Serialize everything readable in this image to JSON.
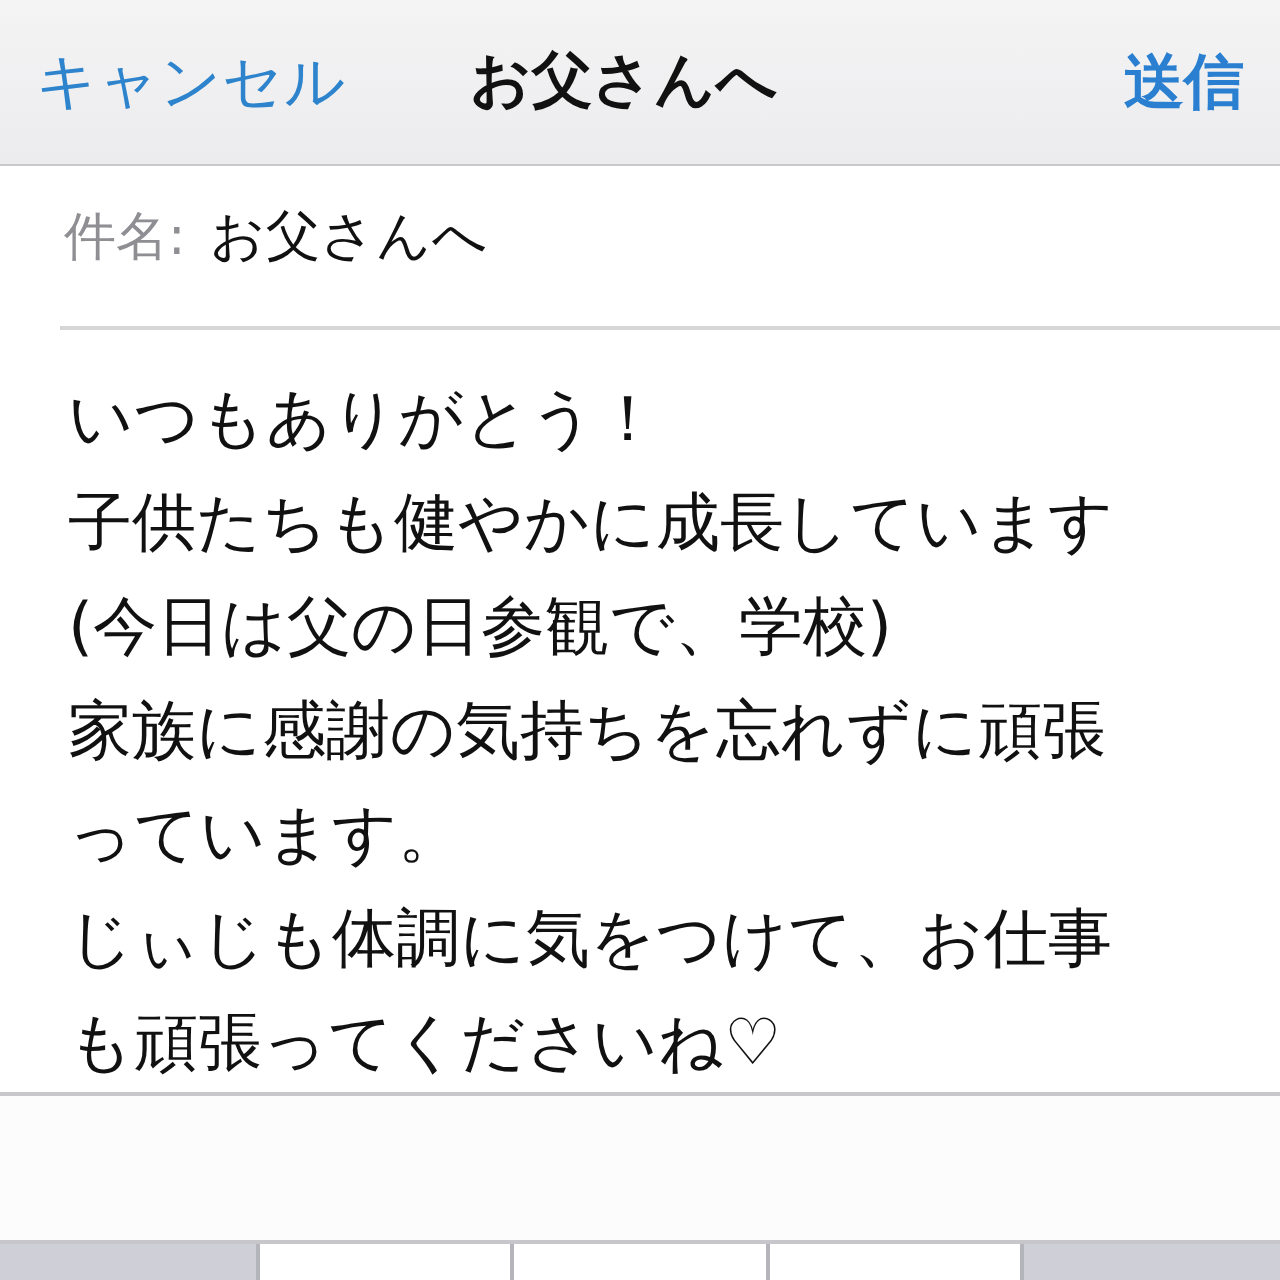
{
  "nav_bar": {
    "cancel": "キャンセル",
    "title": "お父さんへ",
    "send": "送信"
  },
  "subject": {
    "label": "件名:",
    "value": "お父さんへ"
  },
  "body": {
    "lines": [
      "いつもありがとう！",
      "子供たちも健やかに成長しています",
      "(今日は父の日参観で、学校)",
      "家族に感謝の気持ちを忘れずに頑張",
      "っています。",
      "じぃじも体調に気をつけて、お仕事",
      "も頑張ってくださいね♡"
    ]
  },
  "keyboard": {
    "keys": [
      {
        "kind": "function"
      },
      {
        "kind": "letter"
      },
      {
        "kind": "letter"
      },
      {
        "kind": "letter"
      },
      {
        "kind": "function"
      }
    ]
  }
}
